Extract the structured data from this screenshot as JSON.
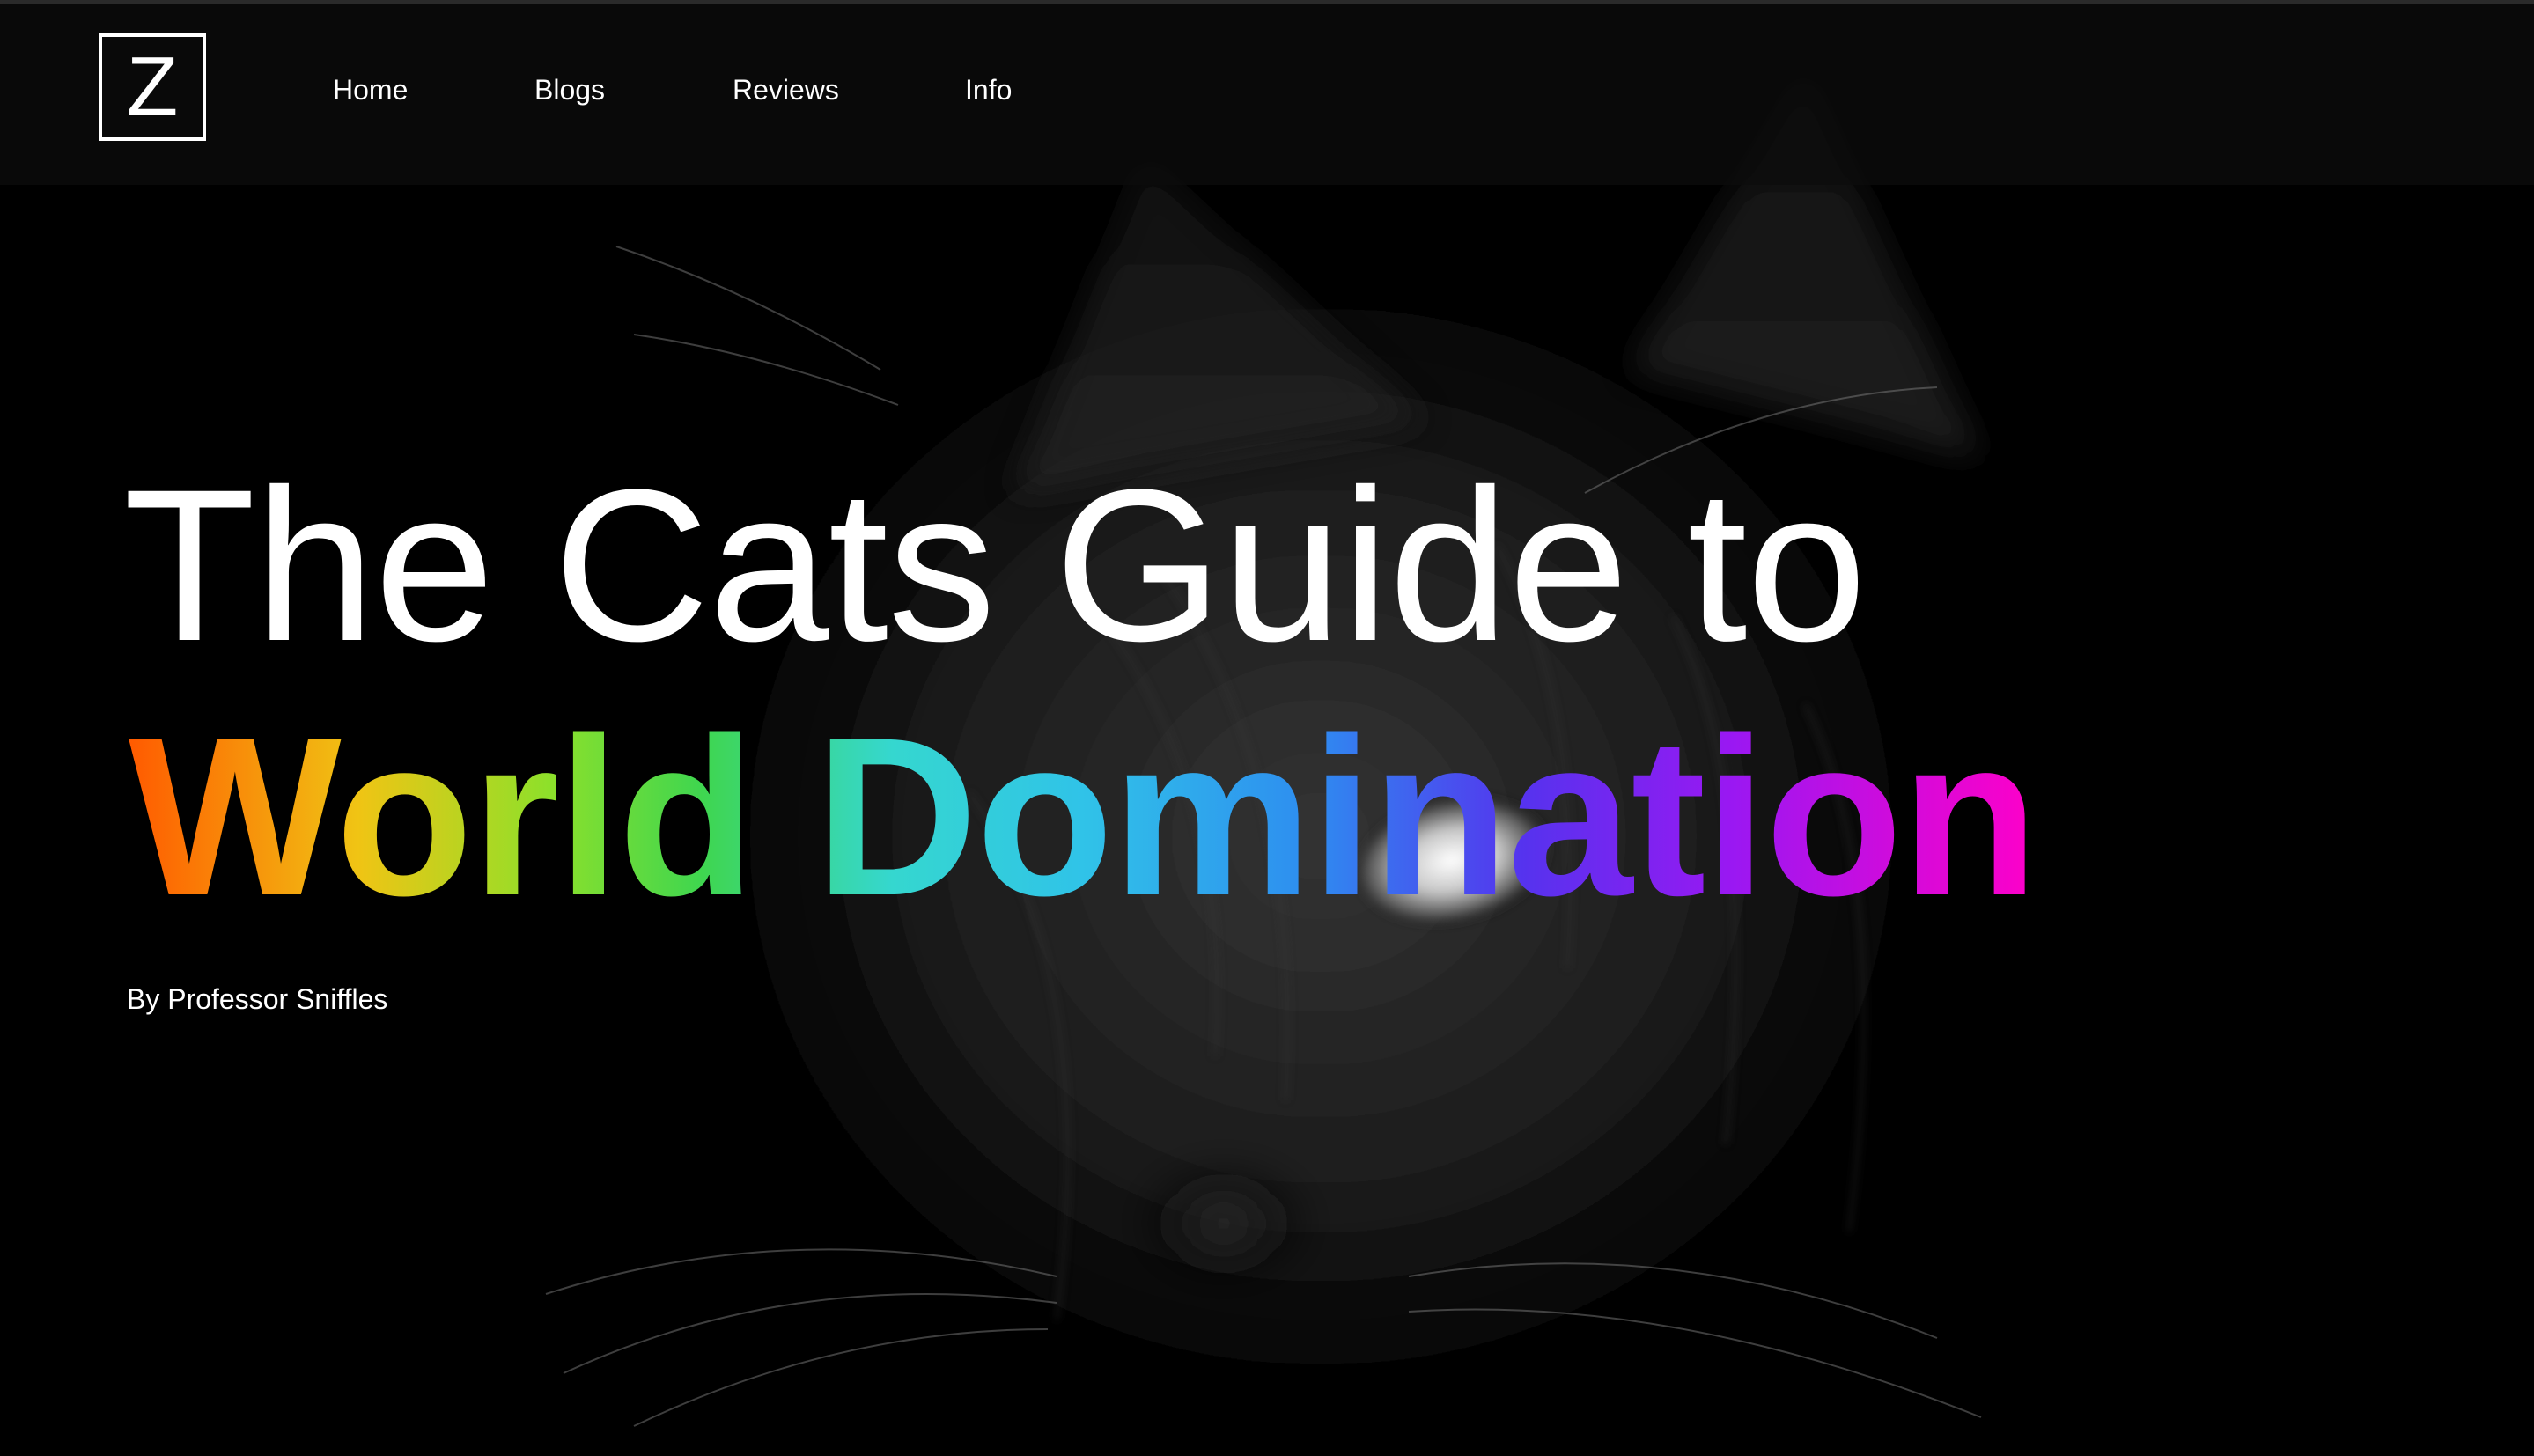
{
  "header": {
    "logo_letter": "Z",
    "nav": [
      {
        "label": "Home"
      },
      {
        "label": "Blogs"
      },
      {
        "label": "Reviews"
      },
      {
        "label": "Info"
      }
    ]
  },
  "hero": {
    "title_line1": "The Cats Guide to",
    "title_line2": "World Domination",
    "byline": "By Professor Sniffles",
    "background": "black-cat-photo"
  },
  "colors": {
    "background": "#000000",
    "text": "#ffffff",
    "gradient": [
      "#ff5a00",
      "#f0c414",
      "#8ee02a",
      "#3fd64f",
      "#35d7cf",
      "#30c3e8",
      "#2e8cf0",
      "#5533ee",
      "#9a18f2",
      "#ff00c8"
    ]
  }
}
